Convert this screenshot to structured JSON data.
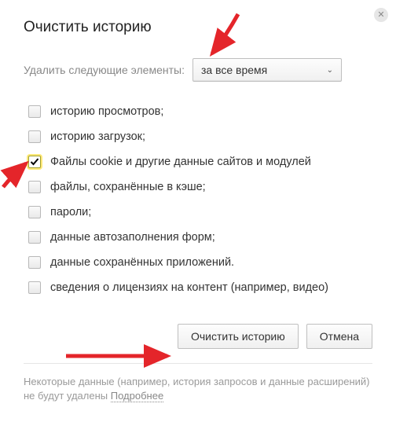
{
  "title": "Очистить историю",
  "period": {
    "label": "Удалить следующие элементы:",
    "selected": "за все время"
  },
  "options": [
    {
      "label": "историю просмотров;",
      "checked": false
    },
    {
      "label": "историю загрузок;",
      "checked": false
    },
    {
      "label": "Файлы cookie и другие данные сайтов и модулей",
      "checked": true
    },
    {
      "label": "файлы, сохранённые в кэше;",
      "checked": false
    },
    {
      "label": "пароли;",
      "checked": false
    },
    {
      "label": "данные автозаполнения форм;",
      "checked": false
    },
    {
      "label": "данные сохранённых приложений.",
      "checked": false
    },
    {
      "label": "сведения о лицензиях на контент (например, видео)",
      "checked": false
    }
  ],
  "buttons": {
    "clear": "Очистить историю",
    "cancel": "Отмена"
  },
  "footer": {
    "text": "Некоторые данные (например, история запросов и данные расширений) не будут удалены ",
    "link": "Подробнее"
  }
}
